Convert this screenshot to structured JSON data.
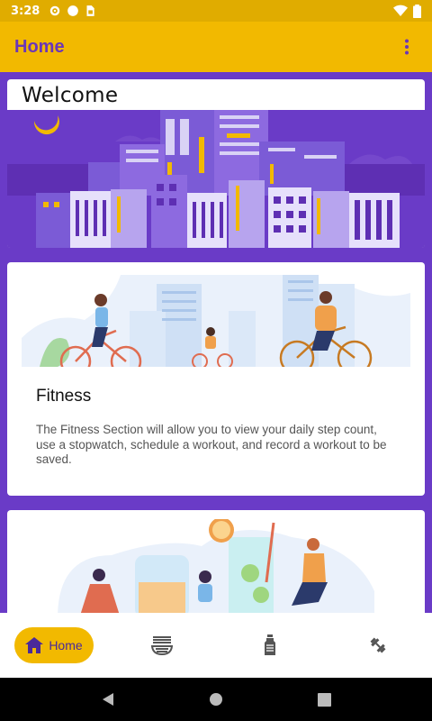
{
  "status_bar": {
    "time": "3:28",
    "icons_left": [
      "settings-icon",
      "circle-icon",
      "sim-card-icon"
    ],
    "icons_right": [
      "wifi-icon",
      "battery-icon"
    ]
  },
  "app_bar": {
    "title": "Home",
    "more_icon": "more-vert-icon"
  },
  "cards": {
    "welcome": {
      "title": "Welcome"
    },
    "fitness": {
      "title": "Fitness",
      "description": "The Fitness Section will allow you to view your daily step count, use a stopwatch, schedule a workout, and record a workout to be saved."
    }
  },
  "bottom_nav": {
    "items": [
      {
        "label": "Home",
        "icon": "home-icon",
        "selected": true
      },
      {
        "label": "",
        "icon": "ramen-bowl-icon",
        "selected": false
      },
      {
        "label": "",
        "icon": "water-bottle-icon",
        "selected": false
      },
      {
        "label": "",
        "icon": "dumbbell-icon",
        "selected": false
      }
    ]
  },
  "system_nav": {
    "icons": [
      "back-icon",
      "home-circle-icon",
      "recents-icon"
    ]
  },
  "colors": {
    "status_bar": "#e0ac00",
    "app_bar": "#f2b900",
    "primary": "#6a3bc7",
    "title_text": "#6b36b8"
  }
}
